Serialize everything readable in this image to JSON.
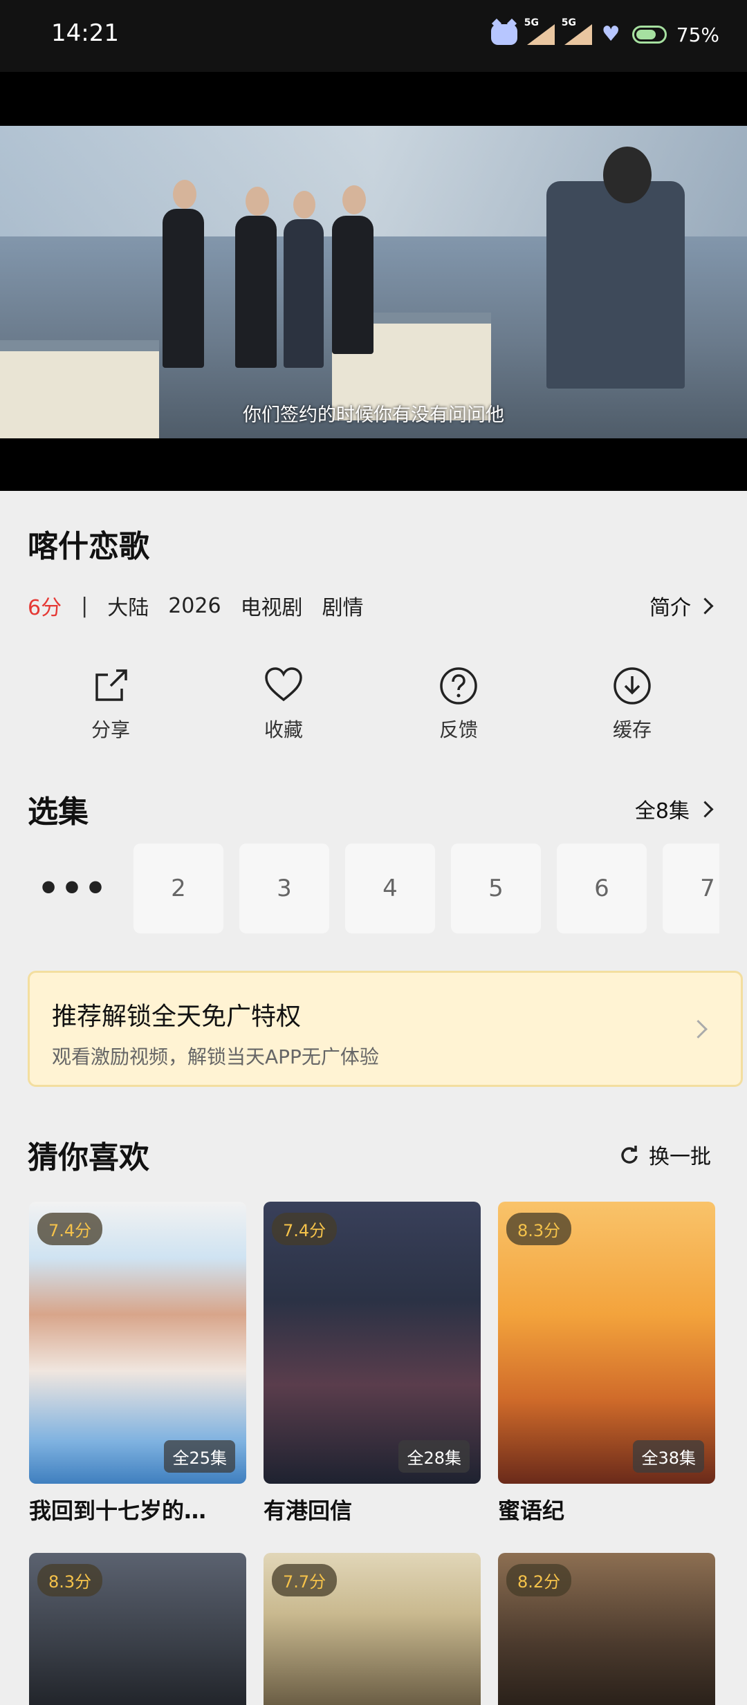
{
  "status_bar": {
    "time": "14:21",
    "signal_label": "5G",
    "battery": "75%"
  },
  "video": {
    "subtitle": "你们签约的时候你有没有问问他"
  },
  "show": {
    "title": "喀什恋歌",
    "score": "6分",
    "separator": "|",
    "tags": [
      "大陆",
      "2026",
      "电视剧",
      "剧情"
    ],
    "intro_label": "简介"
  },
  "actions": [
    {
      "label": "分享",
      "icon": "share-icon"
    },
    {
      "label": "收藏",
      "icon": "heart-icon"
    },
    {
      "label": "反馈",
      "icon": "question-icon"
    },
    {
      "label": "缓存",
      "icon": "download-icon"
    }
  ],
  "episodes": {
    "section_title": "选集",
    "all_label": "全8集",
    "more": "•••",
    "items": [
      "2",
      "3",
      "4",
      "5",
      "6",
      "7"
    ]
  },
  "promo": {
    "title": "推荐解锁全天免广特权",
    "subtitle": "观看激励视频，解锁当天APP无广体验"
  },
  "recommend": {
    "section_title": "猜你喜欢",
    "refresh_label": "换一批",
    "row1": [
      {
        "rating": "7.4分",
        "episodes": "全25集",
        "name": "我回到十七岁的…",
        "color1": "#7fb2e0",
        "color2": "#e7b6a5"
      },
      {
        "rating": "7.4分",
        "episodes": "全28集",
        "name": "有港回信",
        "color1": "#2b3245",
        "color2": "#6c4a5a"
      },
      {
        "rating": "8.3分",
        "episodes": "全38集",
        "name": "蜜语纪",
        "color1": "#f3a33c",
        "color2": "#b3461f"
      }
    ],
    "row2": [
      {
        "rating": "8.3分",
        "color1": "#3a3f48",
        "color2": "#6f7783"
      },
      {
        "rating": "7.7分",
        "color1": "#c9b98f",
        "color2": "#6b5e45"
      },
      {
        "rating": "8.2分",
        "color1": "#4b3a2d",
        "color2": "#8d6f52"
      }
    ]
  },
  "colors": {
    "score": "#e53935",
    "accent_gold": "#f5c24a",
    "promo_bg": "#fff3d3"
  }
}
